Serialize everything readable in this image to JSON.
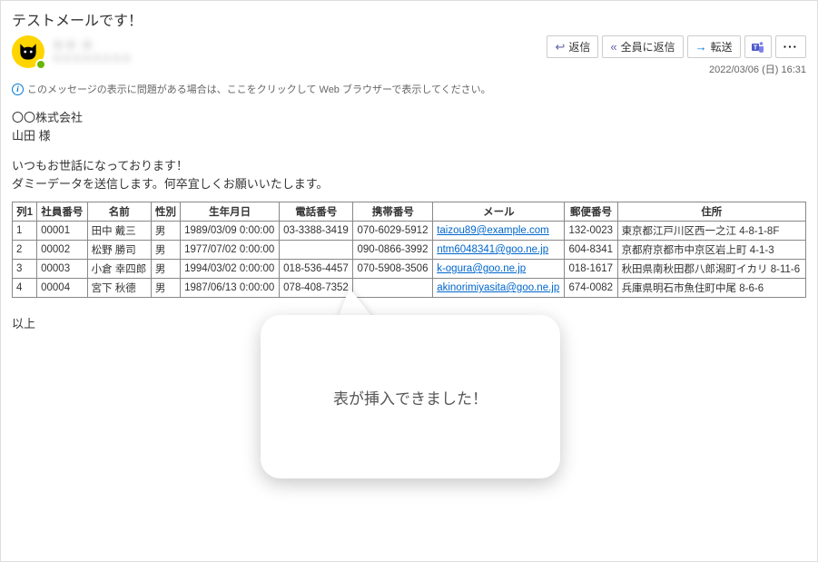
{
  "subject": "テストメールです！",
  "sender": {
    "name_masked": "＊＊ ＊",
    "addr_masked": "＊＊＊＊＊＊＊＊"
  },
  "actions": {
    "reply": "返信",
    "reply_all": "全員に返信",
    "forward": "転送",
    "more": "···"
  },
  "timestamp": "2022/03/06 (日) 16:31",
  "info_message": "このメッセージの表示に問題がある場合は、ここをクリックして Web ブラウザーで表示してください。",
  "greeting": {
    "line1": "〇〇株式会社",
    "line2": "山田 様"
  },
  "intro": {
    "line1": "いつもお世話になっております！",
    "line2": "ダミーデータを送信します。何卒宜しくお願いいたします。"
  },
  "table": {
    "headers": [
      "列1",
      "社員番号",
      "名前",
      "性別",
      "生年月日",
      "電話番号",
      "携帯番号",
      "メール",
      "郵便番号",
      "住所"
    ],
    "rows": [
      {
        "c0": "1",
        "c1": "00001",
        "c2": "田中 戴三",
        "c3": "男",
        "c4": "1989/03/09 0:00:00",
        "c5": "03-3388-3419",
        "c6": "070-6029-5912",
        "c7": "taizou89@example.com",
        "c8": "132-0023",
        "c9": "東京都江戸川区西一之江 4-8-1-8F"
      },
      {
        "c0": "2",
        "c1": "00002",
        "c2": "松野 勝司",
        "c3": "男",
        "c4": "1977/07/02 0:00:00",
        "c5": "",
        "c6": "090-0866-3992",
        "c7": "ntm6048341@goo.ne.jp",
        "c8": "604-8341",
        "c9": "京都府京都市中京区岩上町 4-1-3"
      },
      {
        "c0": "3",
        "c1": "00003",
        "c2": "小倉 幸四郎",
        "c3": "男",
        "c4": "1994/03/02 0:00:00",
        "c5": "018-536-4457",
        "c6": "070-5908-3506",
        "c7": "k-ogura@goo.ne.jp",
        "c8": "018-1617",
        "c9": "秋田県南秋田郡八郎潟町イカリ 8-11-6"
      },
      {
        "c0": "4",
        "c1": "00004",
        "c2": "宮下 秋德",
        "c3": "男",
        "c4": "1987/06/13 0:00:00",
        "c5": "078-408-7352",
        "c6": "",
        "c7": "akinorimiyasita@goo.ne.jp",
        "c8": "674-0082",
        "c9": "兵庫県明石市魚住町中尾 8-6-6"
      }
    ]
  },
  "closing": "以上",
  "callout_text": "表が挿入できました！"
}
